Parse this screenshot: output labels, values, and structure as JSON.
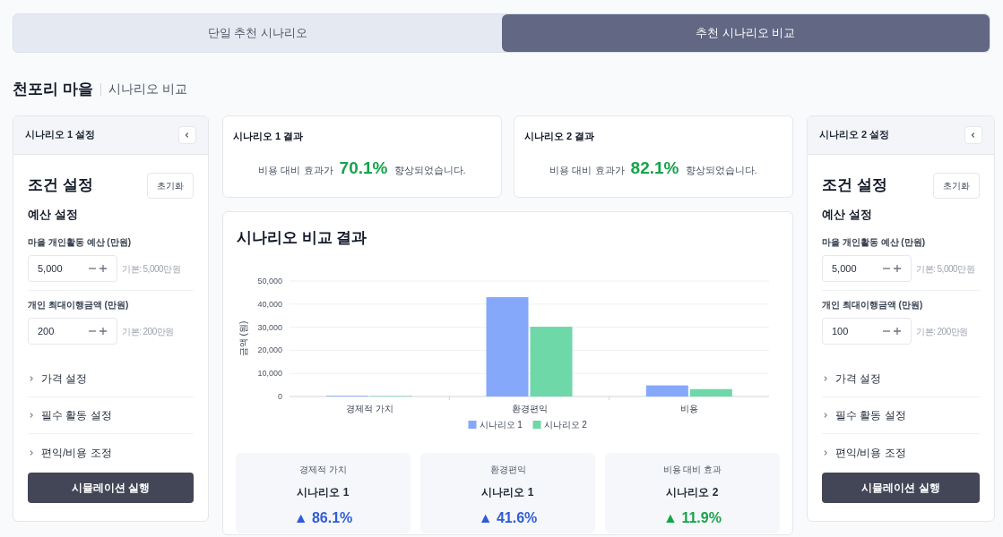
{
  "tabs": [
    {
      "label": "단일 추천 시나리오",
      "selected": false
    },
    {
      "label": "추천 시나리오 비교",
      "selected": true
    }
  ],
  "heading": {
    "title": "천포리 마을",
    "subtitle": "시나리오 비교"
  },
  "panels": [
    {
      "title": "시나리오 1 설정",
      "section_title": "조건 설정",
      "reset": "초기화",
      "group_title": "예산 설정",
      "fields": [
        {
          "label": "마을 개인활동 예산 (만원)",
          "value": "5,000",
          "hint": "기본: 5,000만원"
        },
        {
          "label": "개인 최대이행금액 (만원)",
          "value": "200",
          "hint": "기본: 200만원"
        }
      ],
      "sections": [
        {
          "label": "가격 설정",
          "expanded": false
        },
        {
          "label": "필수 활동 설정",
          "expanded": false
        },
        {
          "label": "편익/비용 조정",
          "expanded": false
        }
      ],
      "run": "시뮬레이션 실행"
    },
    {
      "title": "시나리오 2 설정",
      "section_title": "조건 설정",
      "reset": "초기화",
      "group_title": "예산 설정",
      "fields": [
        {
          "label": "마을 개인활동 예산 (만원)",
          "value": "5,000",
          "hint": "기본: 5,000만원"
        },
        {
          "label": "개인 최대이행금액 (만원)",
          "value": "100",
          "hint": "기본: 200만원"
        }
      ],
      "sections": [
        {
          "label": "가격 설정",
          "expanded": false
        },
        {
          "label": "필수 활동 설정",
          "expanded": false
        },
        {
          "label": "편익/비용 조정",
          "expanded": false
        }
      ],
      "run": "시뮬레이션 실행"
    }
  ],
  "results": [
    {
      "title": "시나리오 1 결과",
      "text": "비용 대비 효과가 **70.1%** 향상되었습니다."
    },
    {
      "title": "시나리오 2 결과",
      "text": "비용 대비 효과가 **82.1%** 향상되었습니다."
    }
  ],
  "comparison": {
    "title": "시나리오 비교 결과",
    "chart_data": {
      "type": "bar",
      "grid": true,
      "legend": true,
      "ylabel": "금액 (원)",
      "categories": [
        "경제적 가치",
        "환경편익",
        "비용"
      ],
      "series": [
        {
          "name": "시나리오 1",
          "color": "#86a8fb",
          "values": [
            300,
            43000,
            4800
          ]
        },
        {
          "name": "시나리오 2",
          "color": "#6ed8a8",
          "values": [
            200,
            30200,
            3200
          ]
        }
      ],
      "ylim": [
        0,
        50000
      ],
      "yticks": [
        {
          "value": 0,
          "label": "0"
        },
        {
          "value": 10000,
          "label": "10,000"
        },
        {
          "value": 20000,
          "label": "20,000"
        },
        {
          "value": 30000,
          "label": "30,000"
        },
        {
          "value": 40000,
          "label": "40,000"
        },
        {
          "value": 50000,
          "label": "50,000"
        }
      ]
    },
    "summary": [
      {
        "label": "경제적 가치",
        "winner": "시나리오 1",
        "change": "▲ 86.1%",
        "color": "#2f5bd8"
      },
      {
        "label": "환경편익",
        "winner": "시나리오 1",
        "change": "▲ 41.6%",
        "color": "#2f5bd8"
      },
      {
        "label": "비용 대비 효과",
        "winner": "시나리오 2",
        "change": "▲ 11.9%",
        "color": "#16a34a"
      }
    ]
  }
}
